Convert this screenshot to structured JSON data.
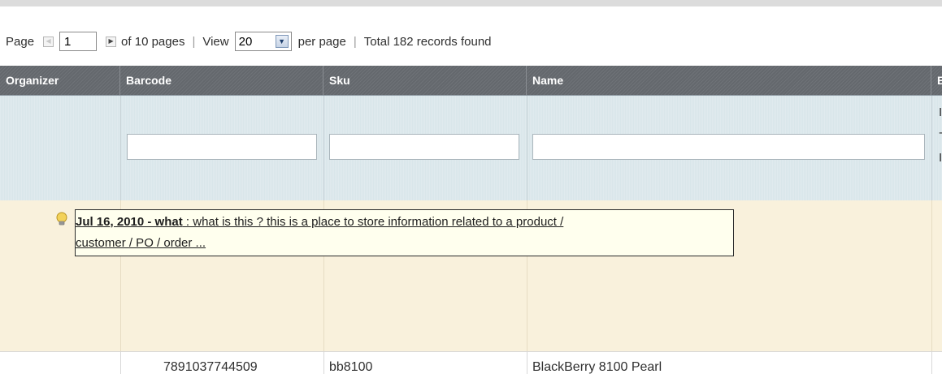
{
  "pager": {
    "page_label": "Page",
    "page_value": "1",
    "of_pages": "of 10 pages",
    "separator": "|",
    "view_label": "View",
    "view_value": "20",
    "per_page": "per page",
    "total": "Total 182 records found"
  },
  "grid": {
    "columns": [
      "Organizer",
      "Barcode",
      "Sku",
      "Name",
      "E"
    ],
    "filter_clipped": [
      "I",
      "-",
      "I"
    ],
    "note": {
      "date_title": "Jul 16, 2010 - what",
      "text": " : what is this ? this is a place to store information related to a product /",
      "continuation": "customer / PO / order ..."
    },
    "rows": [
      {
        "organizer": "",
        "barcode": "7891037744509",
        "sku": "bb8100",
        "name": "BlackBerry 8100 Pearl"
      }
    ]
  },
  "colors": {
    "header_bg": "#6a6e73",
    "filter_bg": "#d9e6ea",
    "note_row_bg": "#f9f1dc",
    "note_bg": "#ffffee"
  },
  "icons": [
    "arrow-left-icon",
    "arrow-right-icon",
    "dropdown-arrow-icon",
    "lightbulb-icon"
  ]
}
